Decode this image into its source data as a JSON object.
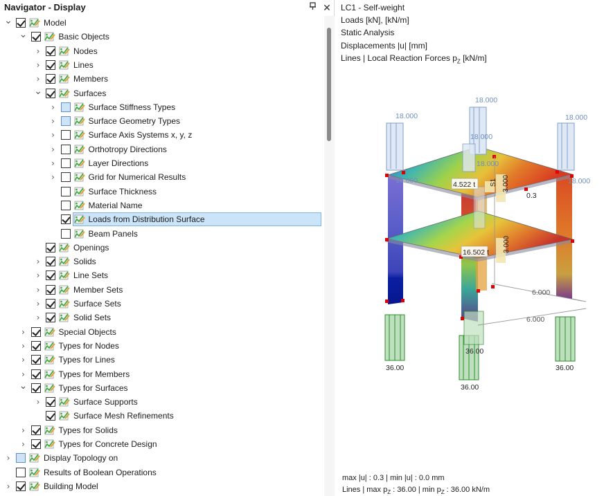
{
  "navigator": {
    "title": "Navigator - Display",
    "pin_icon": "pin-icon",
    "close_icon": "close-icon",
    "items": [
      {
        "label": "Model",
        "level": 0,
        "expander": "open",
        "check": "checked"
      },
      {
        "label": "Basic Objects",
        "level": 1,
        "expander": "open",
        "check": "checked"
      },
      {
        "label": "Nodes",
        "level": 2,
        "expander": "closed",
        "check": "checked"
      },
      {
        "label": "Lines",
        "level": 2,
        "expander": "closed",
        "check": "checked"
      },
      {
        "label": "Members",
        "level": 2,
        "expander": "closed",
        "check": "checked"
      },
      {
        "label": "Surfaces",
        "level": 2,
        "expander": "open",
        "check": "checked"
      },
      {
        "label": "Surface Stiffness Types",
        "level": 3,
        "expander": "closed",
        "check": "partial"
      },
      {
        "label": "Surface Geometry Types",
        "level": 3,
        "expander": "closed",
        "check": "partial"
      },
      {
        "label": "Surface Axis Systems x, y, z",
        "level": 3,
        "expander": "closed",
        "check": "unchecked"
      },
      {
        "label": "Orthotropy Directions",
        "level": 3,
        "expander": "closed",
        "check": "unchecked"
      },
      {
        "label": "Layer Directions",
        "level": 3,
        "expander": "closed",
        "check": "unchecked"
      },
      {
        "label": "Grid for Numerical Results",
        "level": 3,
        "expander": "closed",
        "check": "unchecked"
      },
      {
        "label": "Surface Thickness",
        "level": 3,
        "expander": "none",
        "check": "unchecked"
      },
      {
        "label": "Material Name",
        "level": 3,
        "expander": "none",
        "check": "unchecked"
      },
      {
        "label": "Loads from Distribution Surface",
        "level": 3,
        "expander": "none",
        "check": "checked",
        "selected": true
      },
      {
        "label": "Beam Panels",
        "level": 3,
        "expander": "none",
        "check": "unchecked"
      },
      {
        "label": "Openings",
        "level": 2,
        "expander": "none",
        "check": "checked"
      },
      {
        "label": "Solids",
        "level": 2,
        "expander": "closed",
        "check": "checked"
      },
      {
        "label": "Line Sets",
        "level": 2,
        "expander": "closed",
        "check": "checked"
      },
      {
        "label": "Member Sets",
        "level": 2,
        "expander": "closed",
        "check": "checked"
      },
      {
        "label": "Surface Sets",
        "level": 2,
        "expander": "closed",
        "check": "checked"
      },
      {
        "label": "Solid Sets",
        "level": 2,
        "expander": "closed",
        "check": "checked"
      },
      {
        "label": "Special Objects",
        "level": 1,
        "expander": "closed",
        "check": "checked"
      },
      {
        "label": "Types for Nodes",
        "level": 1,
        "expander": "closed",
        "check": "checked"
      },
      {
        "label": "Types for Lines",
        "level": 1,
        "expander": "closed",
        "check": "checked"
      },
      {
        "label": "Types for Members",
        "level": 1,
        "expander": "closed",
        "check": "checked"
      },
      {
        "label": "Types for Surfaces",
        "level": 1,
        "expander": "open",
        "check": "checked"
      },
      {
        "label": "Surface Supports",
        "level": 2,
        "expander": "closed",
        "check": "checked"
      },
      {
        "label": "Surface Mesh Refinements",
        "level": 2,
        "expander": "none",
        "check": "checked"
      },
      {
        "label": "Types for Solids",
        "level": 1,
        "expander": "closed",
        "check": "checked"
      },
      {
        "label": "Types for Concrete Design",
        "level": 1,
        "expander": "closed",
        "check": "checked"
      },
      {
        "label": "Display Topology on",
        "level": 0,
        "expander": "closed",
        "check": "partial"
      },
      {
        "label": "Results of Boolean Operations",
        "level": 0,
        "expander": "none",
        "check": "unchecked"
      },
      {
        "label": "Building Model",
        "level": 0,
        "expander": "closed",
        "check": "checked"
      }
    ]
  },
  "viewport": {
    "info_lines": [
      "LC1 - Self-weight",
      "Loads [kN], [kN/m]",
      "Static Analysis",
      "Displacements |u| [mm]"
    ],
    "info_last_prefix": "Lines | Local Reaction Forces p",
    "info_last_sub": "Z",
    "info_last_suffix": " [kN/m]",
    "labels": {
      "load_top": "18.000",
      "load_left": "18.000",
      "load_right": "18.000",
      "load_mid_a": "18.000",
      "load_mid_b": "18.000",
      "load_mid_c": "18.000",
      "load_mid_d": "18.000",
      "surface_load_1": "4.522 t",
      "surface_load_2": "16.502 t",
      "s1_label": "S1",
      "dim_height_1": "3.000",
      "dim_height_2": "3.000",
      "displacement": "0.3",
      "dim_len_1": "6.000",
      "dim_len_2": "6.000",
      "reaction_left": "36.00",
      "reaction_mid": "36.00",
      "reaction_right": "36.00",
      "reaction_front": "36.00"
    },
    "footer_line1": "max |u| : 0.3 | min |u| : 0.0 mm",
    "footer_l2_a": "Lines  | max p",
    "footer_l2_sub1": "Z",
    "footer_l2_b": " : 36.00 | min p",
    "footer_l2_sub2": "Z",
    "footer_l2_c": " : 36.00 kN/m"
  },
  "colors": {
    "selection": "#cce4f7",
    "load_arrow": "#7f9fc7",
    "reaction_arrow": "#2e8b2e",
    "support_red": "#e00000"
  }
}
